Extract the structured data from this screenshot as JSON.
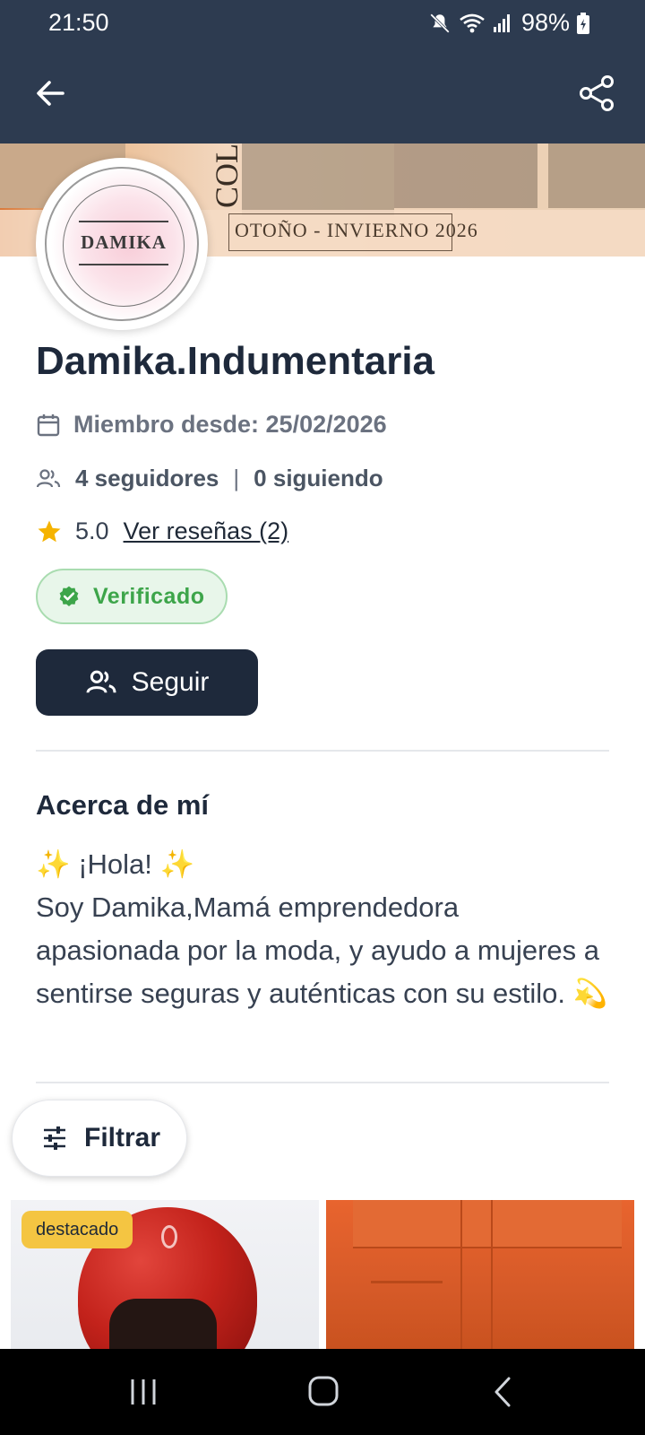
{
  "status_bar": {
    "time": "21:50",
    "battery": "98%"
  },
  "banner": {
    "vertical_text": "COL",
    "season_text": "OTOÑO - INVIERNO 2026"
  },
  "avatar": {
    "logo_text": "DAMIKA"
  },
  "profile": {
    "name": "Damika.Indumentaria",
    "member_since": "Miembro desde: 25/02/2026",
    "followers": "4 seguidores",
    "following": "0 siguiendo",
    "rating": "5.0",
    "reviews_link": "Ver reseñas (2)",
    "verified_label": "Verificado",
    "follow_button": "Seguir"
  },
  "about": {
    "title": "Acerca de mí",
    "text": "✨ ¡Hola! ✨\nSoy Damika,Mamá emprendedora apasionada por la moda, y ayudo a mujeres a sentirse seguras y auténticas con su estilo. 💫"
  },
  "filter": {
    "label": "Filtrar"
  },
  "products": [
    {
      "badge": "destacado"
    },
    {
      "badge": ""
    }
  ],
  "colors": {
    "header": "#2d3b50",
    "primary": "#1e293b",
    "verified_green": "#3da54a",
    "star": "#f5b301",
    "featured_badge": "#f4c542"
  },
  "icons": [
    "back-arrow-icon",
    "share-icon",
    "calendar-icon",
    "people-icon",
    "star-icon",
    "verified-icon",
    "filter-icon",
    "mute-icon",
    "wifi-icon",
    "signal-icon",
    "battery-icon"
  ]
}
